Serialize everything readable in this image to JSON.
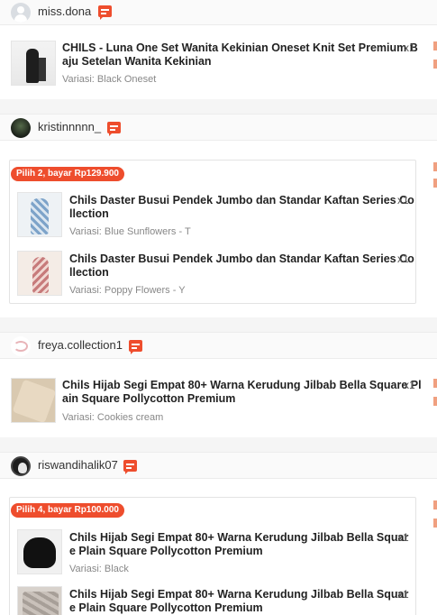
{
  "orders": [
    {
      "shop": "miss.dona",
      "items": [
        {
          "name": "CHILS - Luna One Set Wanita Kekinian Oneset Knit Set Premium B",
          "name2": "aju Setelan Wanita Kekinian",
          "qty": "x1",
          "variant": "Variasi: Black Oneset"
        }
      ]
    },
    {
      "shop": "kristinnnnn_",
      "bundle": "Pilih 2, bayar Rp129.900",
      "items": [
        {
          "name": "Chils Daster Busui Pendek Jumbo dan Standar Kaftan Series Co",
          "name2": "llection",
          "qty": "x1",
          "variant": "Variasi: Blue Sunflowers - T"
        },
        {
          "name": "Chils Daster Busui Pendek Jumbo dan Standar Kaftan Series Co",
          "name2": "llection",
          "qty": "x1",
          "variant": "Variasi: Poppy Flowers - Y"
        }
      ]
    },
    {
      "shop": "freya.collection1",
      "items": [
        {
          "name": "Chils Hijab Segi Empat 80+ Warna Kerudung Jilbab Bella Square Pl",
          "name2": "ain Square Pollycotton Premium",
          "qty": "x1",
          "variant": "Variasi: Cookies cream"
        }
      ]
    },
    {
      "shop": "riswandihalik07",
      "bundle": "Pilih 4, bayar Rp100.000",
      "items": [
        {
          "name": "Chils Hijab Segi Empat 80+ Warna Kerudung Jilbab Bella Squar",
          "name2": "e Plain Square Pollycotton Premium",
          "qty": "x1",
          "variant": "Variasi: Black"
        },
        {
          "name": "Chils Hijab Segi Empat 80+ Warna Kerudung Jilbab Bella Squar",
          "name2": "e Plain Square Pollycotton Premium",
          "qty": "x1",
          "variant": ""
        }
      ]
    }
  ],
  "icons": {
    "chat": "chat-icon",
    "avatar": "avatar"
  },
  "colors": {
    "accent": "#ee4d2d"
  }
}
